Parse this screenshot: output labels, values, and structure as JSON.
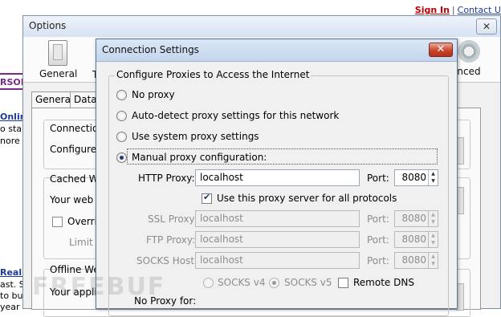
{
  "background_page": {
    "sign_in": "Sign In",
    "separator": "|",
    "contact": "Contact U",
    "frag_rson": "RSON",
    "frag_online": "Online",
    "frag_to_sta": "o sta",
    "frag_more": "nore t",
    "frag_real_e": "Real E",
    "frag_ast": "ast. S",
    "frag_buy": "to buy",
    "frag_year": "year"
  },
  "options": {
    "title": "Options",
    "close_glyph": "✕",
    "toolbar": {
      "general": "General",
      "truncated": "T",
      "advanced": "nced"
    },
    "tabs": {
      "general": "General",
      "data": "Data C"
    },
    "connection_label": "Connection",
    "configure_label": "Configure",
    "cached_label": "Cached We",
    "web_content_label": "Your web c",
    "override_label": "Overrid",
    "limit_label": "Limit c",
    "offline_label": "Offline Web",
    "application_label": "Your applic"
  },
  "connection_settings": {
    "title": "Connection Settings",
    "close_glyph": "✕",
    "heading": "Configure Proxies to Access the Internet",
    "options": {
      "no_proxy": "No proxy",
      "auto_detect": "Auto-detect proxy settings for this network",
      "system": "Use system proxy settings",
      "manual": "Manual proxy configuration:"
    },
    "http": {
      "label": "HTTP Proxy:",
      "value": "localhost",
      "port_label": "Port:",
      "port": "8080"
    },
    "use_for_all": "Use this proxy server for all protocols",
    "ssl": {
      "label": "SSL Proxy:",
      "value": "localhost",
      "port_label": "Port:",
      "port": "8080"
    },
    "ftp": {
      "label": "FTP Proxy:",
      "value": "localhost",
      "port_label": "Port:",
      "port": "8080"
    },
    "socks": {
      "label": "SOCKS Host:",
      "value": "localhost",
      "port_label": "Port:",
      "port": "8080"
    },
    "socks_v4": "SOCKS v4",
    "socks_v5": "SOCKS v5",
    "remote_dns": "Remote DNS",
    "no_proxy_for": "No Proxy for:"
  },
  "watermark": "FREEBUF"
}
